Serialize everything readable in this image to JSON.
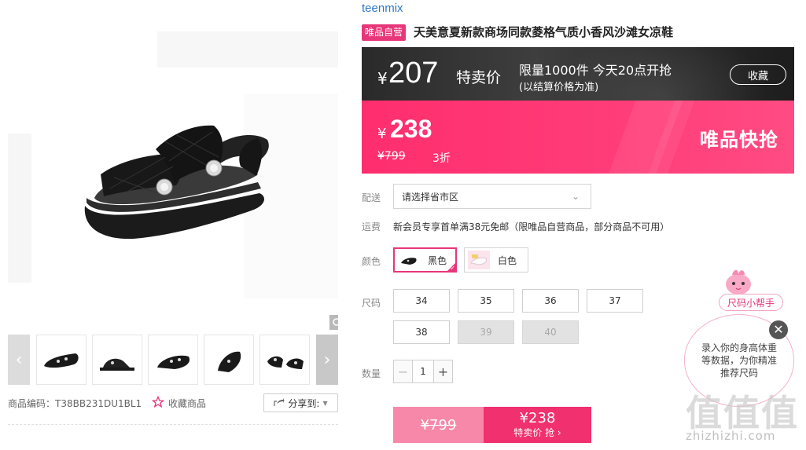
{
  "gallery": {
    "thumbnails": [
      "thumb-1",
      "thumb-2",
      "thumb-3",
      "thumb-4",
      "thumb-5"
    ],
    "sku_label": "商品编码：T38BB231DU1BL1",
    "favorite_label": "收藏商品",
    "share_label": "分享到:"
  },
  "product": {
    "brand": "teenmix",
    "badge": "唯品自营",
    "title": "天美意夏新款商场同款菱格气质小香风沙滩女凉鞋"
  },
  "flash_sale": {
    "currency": "¥",
    "price": "207",
    "label": "特卖价",
    "limit_text": "限量1000件 今天20点开抢",
    "note": "(以结算价格为准)",
    "favorite_button": "收藏"
  },
  "pricing": {
    "currency": "¥",
    "sale_price": "238",
    "original_price": "¥799",
    "discount": "3折",
    "banner_text": "唯品快抢"
  },
  "delivery": {
    "label": "配送",
    "placeholder": "请选择省市区"
  },
  "shipping": {
    "label": "运费",
    "text": "新会员专享首单满38元免邮（限唯品自营商品，部分商品不可用）"
  },
  "colors": {
    "label": "颜色",
    "options": [
      {
        "name": "黑色",
        "selected": true
      },
      {
        "name": "白色",
        "selected": false
      }
    ]
  },
  "sizes": {
    "label": "尺码",
    "options": [
      {
        "value": "34",
        "available": true
      },
      {
        "value": "35",
        "available": true
      },
      {
        "value": "36",
        "available": true
      },
      {
        "value": "37",
        "available": true
      },
      {
        "value": "38",
        "available": true
      },
      {
        "value": "39",
        "available": false
      },
      {
        "value": "40",
        "available": false
      }
    ]
  },
  "quantity": {
    "label": "数量",
    "value": "1",
    "minus": "−",
    "plus": "+"
  },
  "buy": {
    "original_price": "¥799",
    "price": "¥238",
    "label": "特卖价 抢 ›"
  },
  "size_helper": {
    "tag": "尺码小帮手",
    "text": "录入你的身高体重等数据，为你精准推荐尺码",
    "close": "✕"
  },
  "watermark": {
    "logo": "值值值",
    "url": "zhizhizhi.com"
  },
  "colors_theme": {
    "brand_blue": "#2e78c5",
    "vip_pink": "#e8367a",
    "price_bar": "#ff2e6e",
    "buy_button": "#f0306f",
    "buy_button_light": "#f788aa"
  },
  "icons": [
    "zoom-icon",
    "chevron-left-icon",
    "chevron-right-icon",
    "star-icon",
    "share-icon",
    "chevron-down-icon",
    "check-icon",
    "close-icon",
    "mascot-icon"
  ]
}
